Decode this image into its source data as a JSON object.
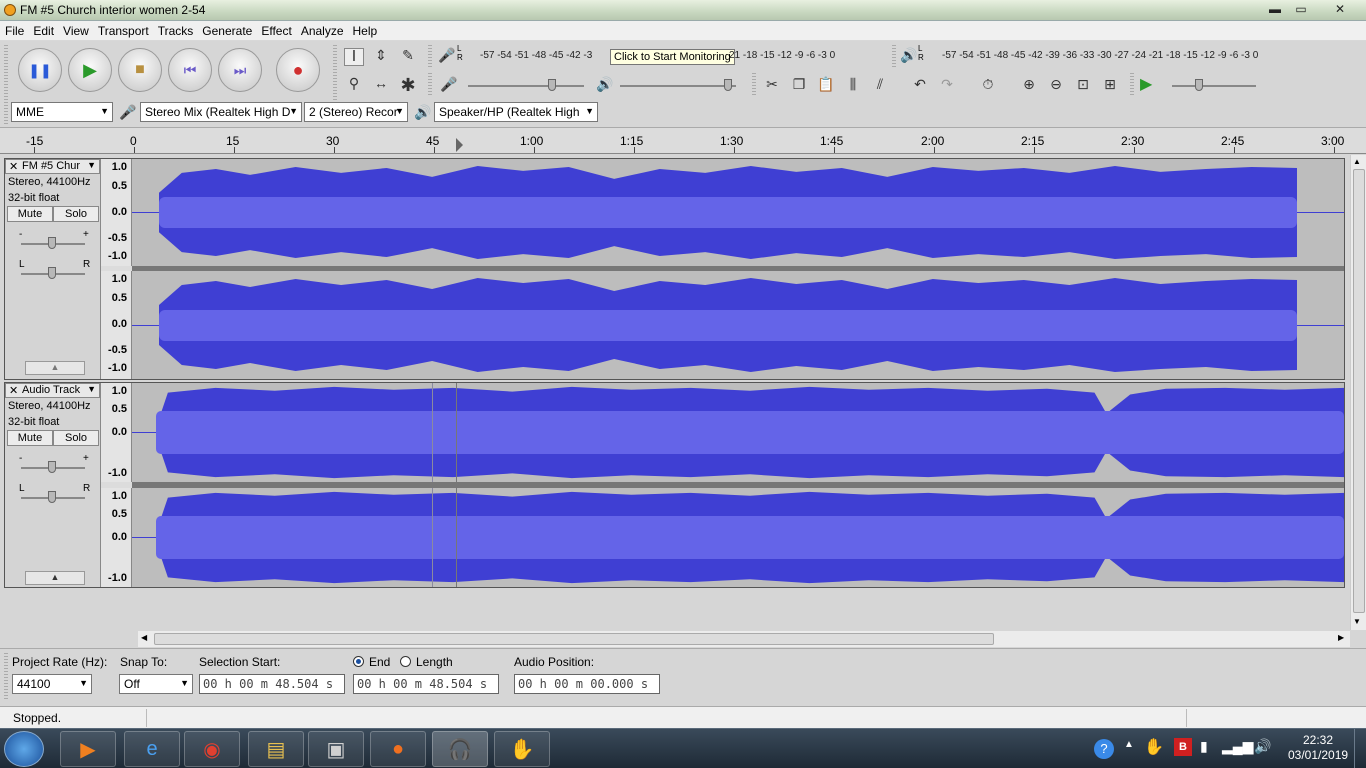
{
  "window": {
    "title": "FM #5 Church interior women 2-54",
    "minimize": "▬",
    "maximize": "▭",
    "close": "✕"
  },
  "menu": [
    "File",
    "Edit",
    "View",
    "Transport",
    "Tracks",
    "Generate",
    "Effect",
    "Analyze",
    "Help"
  ],
  "meters": {
    "record_scale": "-57 -54 -51 -48 -45 -42 -3",
    "record_scale_tail": "21 -18 -15 -12 -9 -6 -3 0",
    "tooltip": "Click to Start Monitoring",
    "play_scale": "-57 -54 -51 -48 -45 -42 -39 -36 -33 -30 -27 -24 -21 -18 -15 -12 -9 -6 -3 0",
    "lr_l": "L",
    "lr_r": "R"
  },
  "devices": {
    "host": "MME",
    "input": "Stereo Mix (Realtek High D",
    "channels": "2 (Stereo) Recor",
    "output": "Speaker/HP (Realtek High"
  },
  "ruler": {
    "ticks": [
      "-15",
      "0",
      "15",
      "30",
      "45",
      "1:00",
      "1:15",
      "1:30",
      "1:45",
      "2:00",
      "2:15",
      "2:30",
      "2:45",
      "3:00"
    ]
  },
  "tracks": [
    {
      "name": "FM #5 Chur",
      "line1": "Stereo, 44100Hz",
      "line2": "32-bit float",
      "mute": "Mute",
      "solo": "Solo",
      "gain_minus": "-",
      "gain_plus": "+",
      "pan_l": "L",
      "pan_r": "R",
      "scale1": [
        "1.0",
        "0.5",
        "0.0",
        "-0.5",
        "-1.0"
      ],
      "scale2": [
        "1.0",
        "0.5",
        "0.0",
        "-0.5",
        "-1.0"
      ]
    },
    {
      "name": "Audio Track",
      "line1": "Stereo, 44100Hz",
      "line2": "32-bit float",
      "mute": "Mute",
      "solo": "Solo",
      "gain_minus": "-",
      "gain_plus": "+",
      "pan_l": "L",
      "pan_r": "R",
      "scale1": [
        "1.0",
        "0.5",
        "0.0",
        "-1.0"
      ],
      "scale2": [
        "1.0",
        "0.5",
        "0.0",
        "-1.0"
      ]
    }
  ],
  "selection": {
    "rate_label": "Project Rate (Hz):",
    "rate_value": "44100",
    "snap_label": "Snap To:",
    "snap_value": "Off",
    "start_label": "Selection Start:",
    "start_value": "00 h 00 m 48.504 s",
    "end_label": "End",
    "length_label": "Length",
    "end_value": "00 h 00 m 48.504 s",
    "pos_label": "Audio Position:",
    "pos_value": "00 h 00 m 00.000 s"
  },
  "status": {
    "text": "Stopped."
  },
  "taskbar": {
    "time": "22:32",
    "date": "03/01/2019"
  },
  "colors": {
    "wave": "#3f3fd3",
    "wave_rms": "#6464e8",
    "wave_bg": "#bdbdbd"
  }
}
